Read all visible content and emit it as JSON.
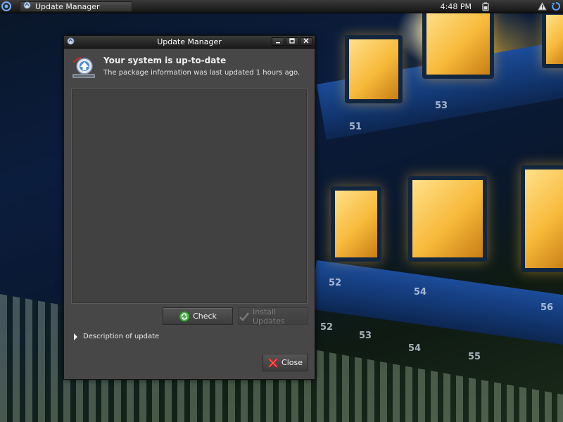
{
  "panel": {
    "task_title": "Update Manager",
    "clock": "4:48 PM"
  },
  "window": {
    "title": "Update Manager",
    "header_title": "Your system is up-to-date",
    "header_subtitle": "The package information was last updated 1 hours ago."
  },
  "buttons": {
    "check_label": "Check",
    "install_label": "Install Updates",
    "close_label": "Close"
  },
  "expander": {
    "label": "Description of update"
  },
  "background_numbers": [
    "53",
    "51",
    "52",
    "54",
    "52",
    "53",
    "54",
    "55",
    "56"
  ]
}
